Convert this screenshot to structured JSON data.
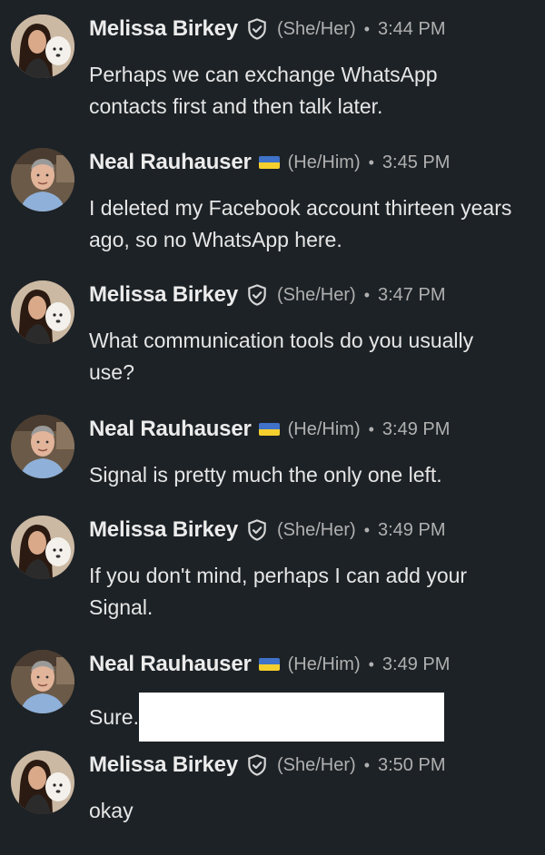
{
  "users": {
    "melissa": {
      "name": "Melissa Birkey",
      "pronouns": "(She/Her)",
      "badge_icon": "verified-shield-icon"
    },
    "neal": {
      "name": "Neal Rauhauser",
      "pronouns": "(He/Him)",
      "flag_icon": "ukraine-flag-icon",
      "flag_colors": [
        "#3f72c8",
        "#f5cf2e"
      ]
    }
  },
  "separator": "•",
  "messages": [
    {
      "author": "Melissa Birkey",
      "pronouns": "(She/Her)",
      "time": "3:44 PM",
      "text": "Perhaps we can exchange WhatsApp contacts first and then talk later."
    },
    {
      "author": "Neal Rauhauser",
      "pronouns": "(He/Him)",
      "time": "3:45 PM",
      "text": "I deleted my Facebook account thirteen years ago, so no WhatsApp here."
    },
    {
      "author": "Melissa Birkey",
      "pronouns": "(She/Her)",
      "time": "3:47 PM",
      "text": "What communication tools do you usually use?"
    },
    {
      "author": "Neal Rauhauser",
      "pronouns": "(He/Him)",
      "time": "3:49 PM",
      "text": "Signal is pretty much the only one left."
    },
    {
      "author": "Melissa Birkey",
      "pronouns": "(She/Her)",
      "time": "3:49 PM",
      "text": "If you don't mind, perhaps I can add your Signal."
    },
    {
      "author": "Neal Rauhauser",
      "pronouns": "(He/Him)",
      "time": "3:49 PM",
      "text": "Sure.",
      "redacted": true
    },
    {
      "author": "Melissa Birkey",
      "pronouns": "(She/Her)",
      "time": "3:50 PM",
      "text": "okay"
    }
  ],
  "colors": {
    "background": "#1d2226",
    "name": "#ececec",
    "meta": "#b0b0b0",
    "body": "#e6e6e6",
    "redaction": "#ffffff"
  }
}
